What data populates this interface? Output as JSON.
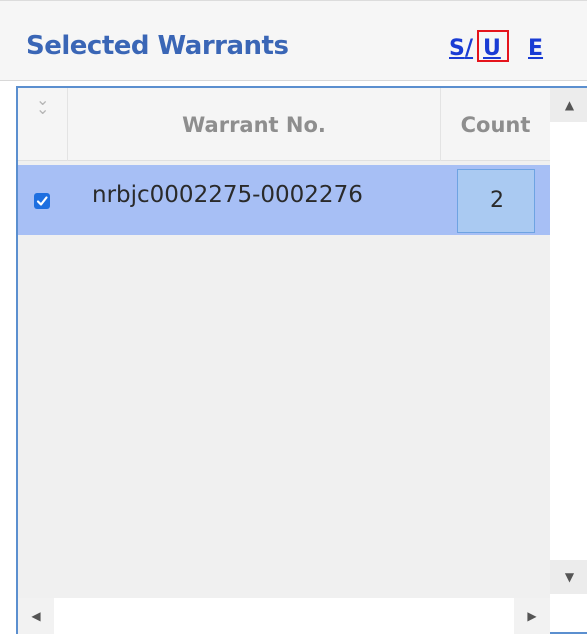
{
  "panel": {
    "title": "Selected Warrants",
    "links": {
      "s": "S",
      "separator": "/",
      "u": "U",
      "e": "E"
    }
  },
  "grid": {
    "columns": {
      "select_all_icon": "double-chevron-down-icon",
      "warrant": "Warrant No.",
      "count": "Count"
    },
    "rows": [
      {
        "checked": true,
        "warrant_no": "nrbjc0002275-0002276",
        "count": "2"
      }
    ]
  },
  "colors": {
    "title": "#3a66b6",
    "link": "#1a3cd4",
    "highlight_box": "#e5141c",
    "selected_row": "#a7bff5",
    "frame": "#5b8fcf"
  }
}
